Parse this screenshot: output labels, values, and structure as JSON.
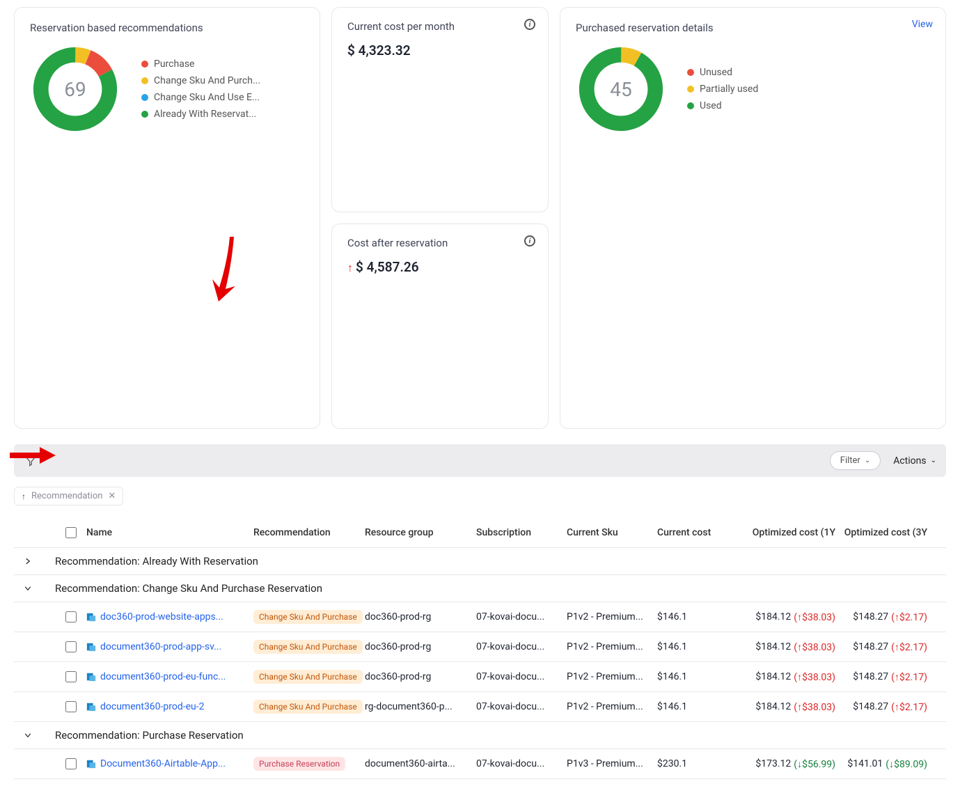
{
  "reservationReco": {
    "title": "Reservation based recommendations",
    "count": "69",
    "legend": [
      {
        "color": "#eb4d3d",
        "label": "Purchase"
      },
      {
        "color": "#f2c024",
        "label": "Change Sku And Purch..."
      },
      {
        "color": "#29a3e6",
        "label": "Change Sku And Use E..."
      },
      {
        "color": "#25a244",
        "label": "Already With Reservat..."
      }
    ]
  },
  "currentCost": {
    "title": "Current cost per month",
    "value": "$ 4,323.32"
  },
  "afterReservation": {
    "title": "Cost after reservation",
    "value": "$ 4,587.26"
  },
  "purchased": {
    "title": "Purchased reservation details",
    "viewLabel": "View",
    "count": "45",
    "legend": [
      {
        "color": "#eb4d3d",
        "label": "Unused"
      },
      {
        "color": "#f2c024",
        "label": "Partially used"
      },
      {
        "color": "#25a244",
        "label": "Used"
      }
    ]
  },
  "toolbar": {
    "filterLabel": "Filter",
    "actionsLabel": "Actions"
  },
  "groupChip": "Recommendation",
  "headers": {
    "name": "Name",
    "rec": "Recommendation",
    "rg": "Resource group",
    "sub": "Subscription",
    "sku": "Current Sku",
    "cost": "Current cost",
    "op1": "Optimized cost (1Y",
    "op3": "Optimized cost (3Y"
  },
  "groups": [
    {
      "expanded": false,
      "label": "Recommendation: Already With Reservation",
      "rows": []
    },
    {
      "expanded": true,
      "label": "Recommendation: Change Sku And Purchase Reservation",
      "rows": [
        {
          "name": "doc360-prod-website-apps...",
          "badge": "Change Sku And Purchase",
          "badgeClass": "badge-orange",
          "rg": "doc360-prod-rg",
          "sub": "07-kovai-docu...",
          "sku": "P1v2 - Premium...",
          "cost": "$146.1",
          "op1v": "$184.12",
          "op1d": "(↑$38.03)",
          "op1dir": "up",
          "op3v": "$148.27",
          "op3d": "(↑$2.17)",
          "op3dir": "up"
        },
        {
          "name": "document360-prod-app-sv...",
          "badge": "Change Sku And Purchase",
          "badgeClass": "badge-orange",
          "rg": "doc360-prod-rg",
          "sub": "07-kovai-docu...",
          "sku": "P1v2 - Premium...",
          "cost": "$146.1",
          "op1v": "$184.12",
          "op1d": "(↑$38.03)",
          "op1dir": "up",
          "op3v": "$148.27",
          "op3d": "(↑$2.17)",
          "op3dir": "up"
        },
        {
          "name": "document360-prod-eu-func...",
          "badge": "Change Sku And Purchase",
          "badgeClass": "badge-orange",
          "rg": "doc360-prod-rg",
          "sub": "07-kovai-docu...",
          "sku": "P1v2 - Premium...",
          "cost": "$146.1",
          "op1v": "$184.12",
          "op1d": "(↑$38.03)",
          "op1dir": "up",
          "op3v": "$148.27",
          "op3d": "(↑$2.17)",
          "op3dir": "up"
        },
        {
          "name": "document360-prod-eu-2",
          "badge": "Change Sku And Purchase",
          "badgeClass": "badge-orange",
          "rg": "rg-document360-p...",
          "sub": "07-kovai-docu...",
          "sku": "P1v2 - Premium...",
          "cost": "$146.1",
          "op1v": "$184.12",
          "op1d": "(↑$38.03)",
          "op1dir": "up",
          "op3v": "$148.27",
          "op3d": "(↑$2.17)",
          "op3dir": "up"
        }
      ]
    },
    {
      "expanded": true,
      "label": "Recommendation: Purchase Reservation",
      "rows": [
        {
          "name": "Document360-Airtable-App...",
          "badge": "Purchase Reservation",
          "badgeClass": "badge-pink",
          "rg": "document360-airta...",
          "sub": "07-kovai-docu...",
          "sku": "P1v3 - Premium...",
          "cost": "$230.1",
          "op1v": "$173.12",
          "op1d": "(↓$56.99)",
          "op1dir": "down",
          "op3v": "$141.01",
          "op3d": "(↓$89.09)",
          "op3dir": "down"
        }
      ]
    }
  ]
}
